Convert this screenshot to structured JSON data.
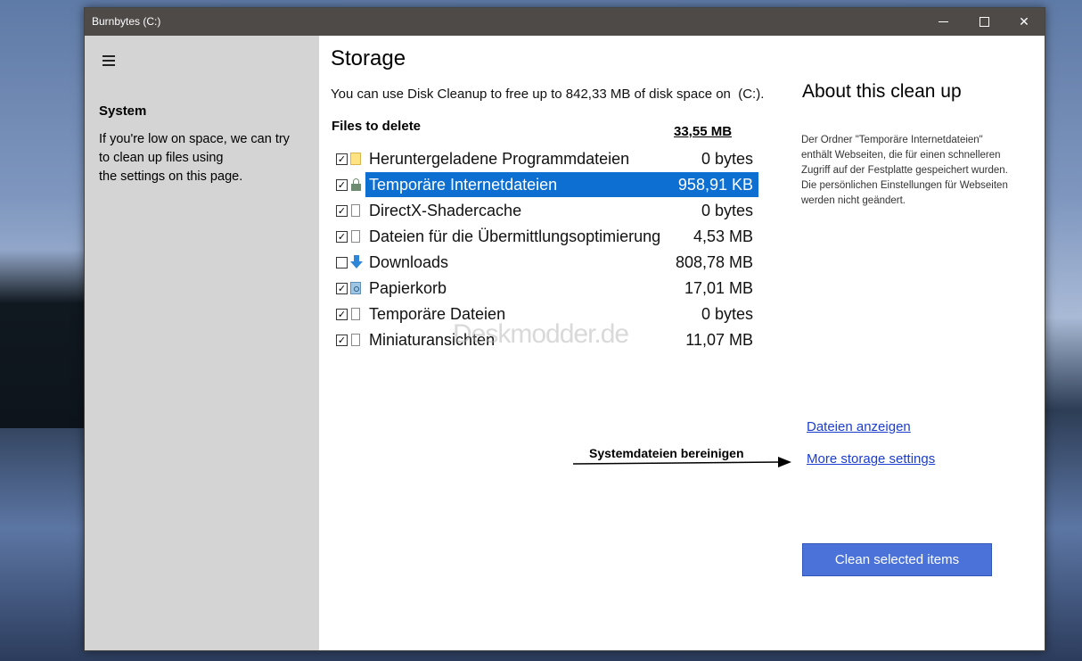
{
  "window": {
    "title": "Burnbytes (C:)"
  },
  "sidebar": {
    "section_title": "System",
    "description": "If you're low on space, we can try\nto clean up files using\nthe settings on this page."
  },
  "main": {
    "title": "Storage",
    "intro": "You can use Disk Cleanup to free up to 842,33 MB of disk space on  (C:).",
    "files_label": "Files to delete",
    "total": "33,55 MB",
    "files": [
      {
        "name": "Heruntergeladene Programmdateien",
        "size": "0 bytes",
        "checked": true,
        "icon": "folder-icon"
      },
      {
        "name": "Temporäre Internetdateien",
        "size": "958,91 KB",
        "checked": true,
        "icon": "lock-icon",
        "selected": true
      },
      {
        "name": "DirectX-Shadercache",
        "size": "0 bytes",
        "checked": true,
        "icon": "document-icon"
      },
      {
        "name": "Dateien für die Übermittlungsoptimierung",
        "size": "4,53 MB",
        "checked": true,
        "icon": "document-icon"
      },
      {
        "name": "Downloads",
        "size": "808,78 MB",
        "checked": false,
        "icon": "download-icon"
      },
      {
        "name": "Papierkorb",
        "size": "17,01 MB",
        "checked": true,
        "icon": "recycle-bin-icon"
      },
      {
        "name": "Temporäre Dateien",
        "size": "0 bytes",
        "checked": true,
        "icon": "document-icon"
      },
      {
        "name": "Miniaturansichten",
        "size": "11,07 MB",
        "checked": true,
        "icon": "document-icon"
      }
    ],
    "watermark": "Deskmodder.de"
  },
  "about": {
    "title": "About this clean up",
    "text": "Der Ordner \"Temporäre Internetdateien\" enthält Webseiten, die für einen schnelleren Zugriff auf der Festplatte gespeichert wurden. Die persönlichen Einstellungen für Webseiten werden nicht geändert."
  },
  "links": {
    "show_files": "Dateien anzeigen",
    "more_settings": "More storage settings"
  },
  "annotation": "Systemdateien bereinigen",
  "actions": {
    "clean": "Clean selected items"
  },
  "colors": {
    "titlebar": "#4d4a48",
    "sidebar": "#d4d4d4",
    "selection": "#0d6fd1",
    "accent_button": "#4a72d8",
    "link": "#1a3dcf"
  }
}
